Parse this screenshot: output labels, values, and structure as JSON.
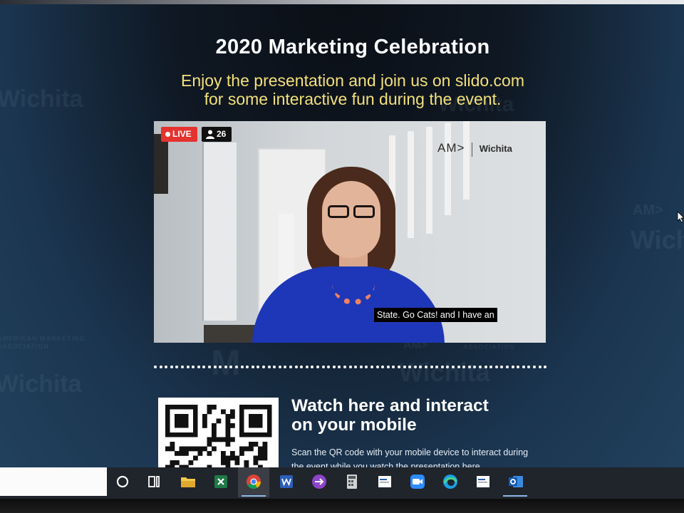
{
  "event": {
    "title": "2020 Marketing Celebration",
    "subtitle_line1": "Enjoy the presentation and join us on slido.com",
    "subtitle_line2": "for some interactive fun during the event."
  },
  "stream": {
    "live_label": "LIVE",
    "viewer_count": "26",
    "brand_logo": "AM>",
    "brand_name": "Wichita",
    "caption": "State. Go Cats! and I have an"
  },
  "interact": {
    "title_line1": "Watch here and interact",
    "title_line2": "on your mobile",
    "description_line1": "Scan the QR code with your mobile device to interact during",
    "description_line2": "the event while you watch the presentation here."
  },
  "watermarks": {
    "logo": "AM>",
    "name": "Wichita",
    "association_line1": "AMERICAN MARKETING",
    "association_line2": "ASSOCIATION",
    "association": "ASSOCIATION",
    "monogram": "M"
  },
  "taskbar": {
    "items": [
      {
        "icon": "cortana-icon"
      },
      {
        "icon": "task-view-icon"
      },
      {
        "icon": "file-explorer-icon"
      },
      {
        "icon": "excel-icon"
      },
      {
        "icon": "chrome-icon"
      },
      {
        "icon": "word-icon"
      },
      {
        "icon": "power-automate-icon"
      },
      {
        "icon": "calculator-icon"
      },
      {
        "icon": "document-icon"
      },
      {
        "icon": "zoom-icon"
      },
      {
        "icon": "edge-icon"
      },
      {
        "icon": "document-icon"
      },
      {
        "icon": "outlook-icon"
      }
    ],
    "active_item": "chrome-icon"
  },
  "colors": {
    "live_red": "#e4332f",
    "subtitle_yellow": "#f3e07a",
    "sweater_blue": "#1e37b8",
    "screen_blue": "#22425e"
  }
}
